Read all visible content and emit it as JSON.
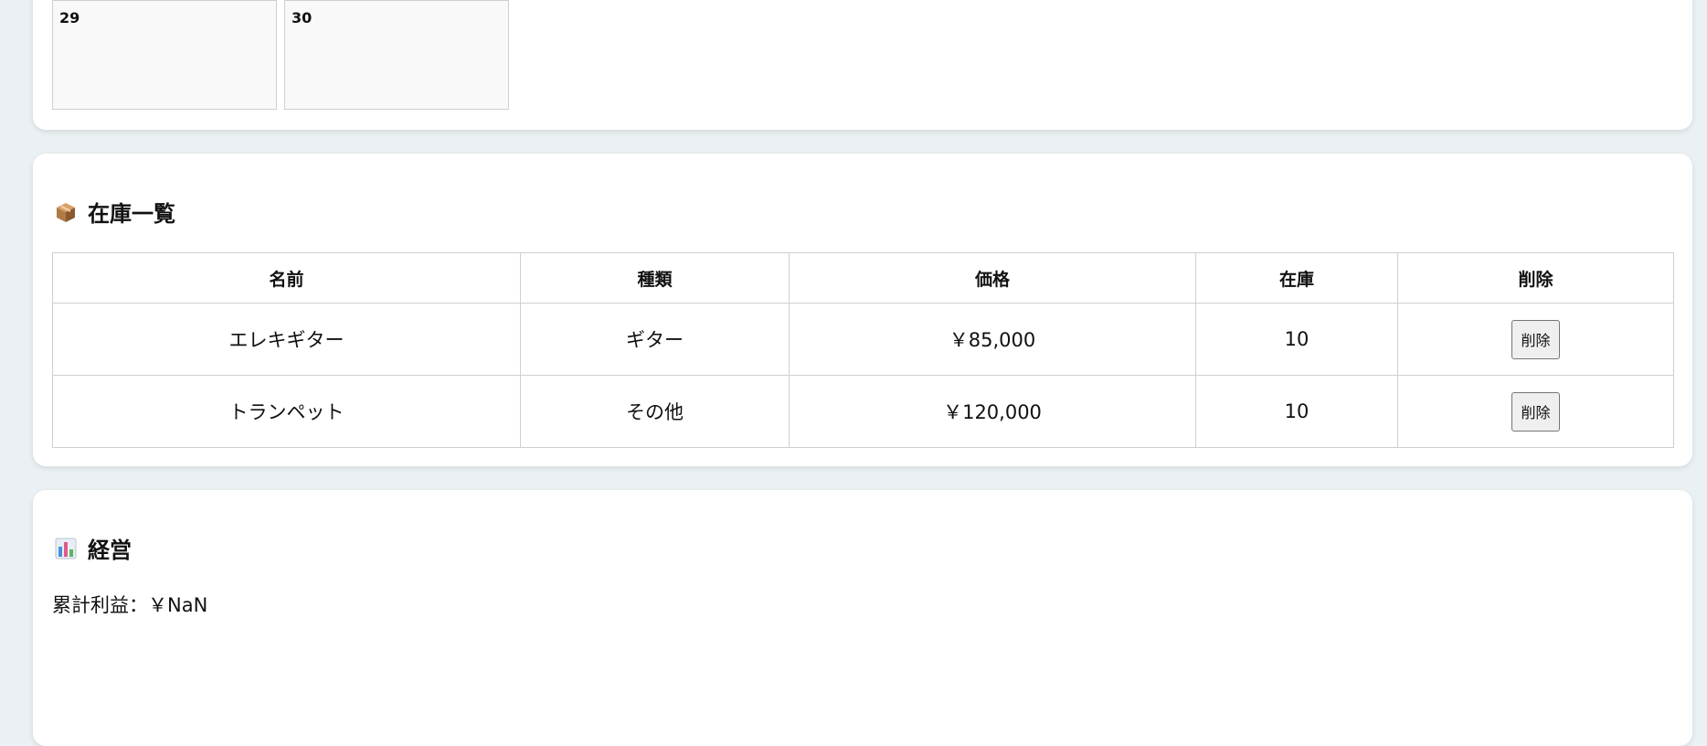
{
  "calendar": {
    "days": [
      "29",
      "30"
    ]
  },
  "inventory": {
    "title": "在庫一覧",
    "icon": "package-icon",
    "columns": [
      "名前",
      "種類",
      "価格",
      "在庫",
      "削除"
    ],
    "rows": [
      {
        "name": "エレキギター",
        "type": "ギター",
        "price": "￥85,000",
        "stock": "10",
        "delete_label": "削除"
      },
      {
        "name": "トランペット",
        "type": "その他",
        "price": "￥120,000",
        "stock": "10",
        "delete_label": "削除"
      }
    ]
  },
  "management": {
    "title": "経営",
    "icon": "bar-chart-icon",
    "profit_label": "累計利益：￥NaN"
  }
}
